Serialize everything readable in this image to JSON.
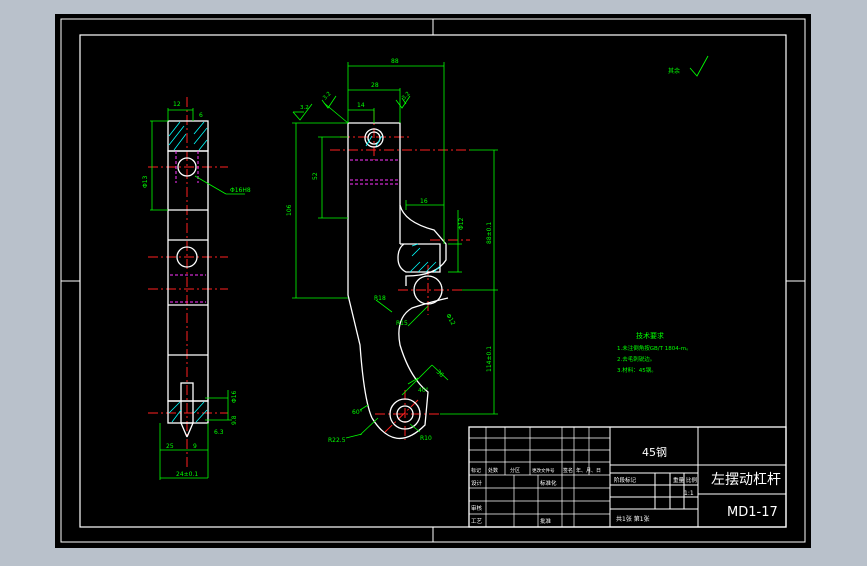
{
  "colors": {
    "viewport_bg": "#b9c1cb",
    "sheet": "#000000",
    "border": "#ffffff",
    "part_outline": "#ffffff",
    "centerline": "#ff2020",
    "dimension": "#00ff00",
    "hidden_line": "#ff33ff",
    "hatch": "#00ffff",
    "notes_text": "#00ff00"
  },
  "drawing": {
    "surface_mark": "其余",
    "dims": {
      "w12": "12",
      "w6": "6",
      "phi13": "Φ13",
      "phi16H8": "Φ16H8",
      "phi16": "Φ16",
      "w9_8": "9.8",
      "h6_3": "6.3",
      "w25": "25",
      "w9": "9",
      "w24": "24±0.1",
      "top88": "88",
      "top28": "28",
      "top14": "14",
      "ra32": "3.2",
      "ra32b": "3.2",
      "ra32c": "3.2",
      "h106": "106",
      "h52": "52",
      "w16": "16",
      "phi12": "Φ12",
      "phi12b": "Φ12",
      "h88pm": "88±0.1",
      "h114pm": "114±0.1",
      "r18": "R18",
      "r15": "R15",
      "r22_5": "R22.5",
      "r10": "R10",
      "d36": "36",
      "a40": "40°",
      "a60": "60°"
    }
  },
  "notes": {
    "title": "技术要求",
    "items": [
      "1.未注倒角按GB/T 1804-m。",
      "2.去毛刺锐边。",
      "3.材料：45钢。"
    ]
  },
  "title_block": {
    "material": "45钢",
    "part_name": "左摆动杠杆",
    "drawing_no": "MD1-17",
    "header_row": [
      "标记",
      "处数",
      "分区",
      "更改文件号",
      "签名",
      "年、月、日"
    ],
    "row_design": "设计",
    "row_standard": "标准化",
    "row_review": "审核",
    "row_process": "工艺",
    "row_approve": "批准",
    "stage_headers": [
      "阶段标记",
      "重量",
      "比例"
    ],
    "scale": "1:1",
    "sheet_info": "共1张 第1张"
  }
}
